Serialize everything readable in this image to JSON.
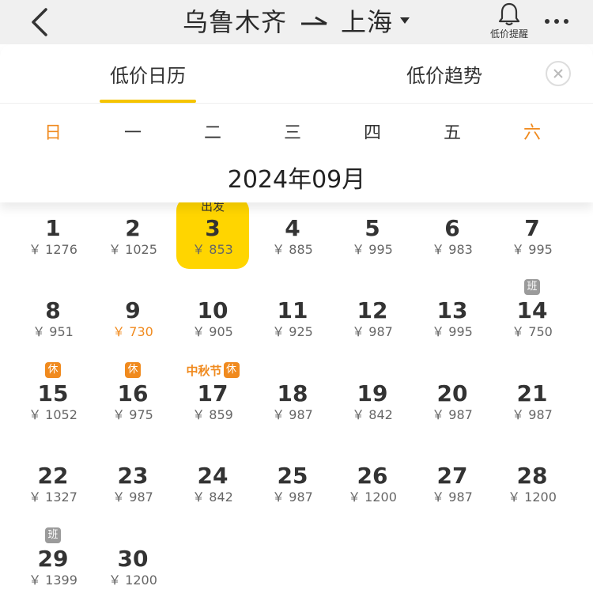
{
  "nav": {
    "origin": "乌鲁木齐",
    "destination": "上海",
    "alert_label": "低价提醒"
  },
  "tabs": {
    "calendar": "低价日历",
    "trend": "低价趋势"
  },
  "weekdays": [
    "日",
    "一",
    "二",
    "三",
    "四",
    "五",
    "六"
  ],
  "month_title": "2024年09月",
  "colors": {
    "accent": "#ffd500",
    "tab_underline": "#f5c400",
    "weekend": "#f08a1e",
    "rest_badge": "#f08a1e",
    "work_badge": "#9b9b9b"
  },
  "currency": "￥",
  "selected_label": "出发",
  "badge_labels": {
    "rest": "休",
    "work": "班"
  },
  "days": [
    {
      "day": "1",
      "price": "1276"
    },
    {
      "day": "2",
      "price": "1025"
    },
    {
      "day": "3",
      "price": "853",
      "selected": true
    },
    {
      "day": "4",
      "price": "885"
    },
    {
      "day": "5",
      "price": "995"
    },
    {
      "day": "6",
      "price": "983"
    },
    {
      "day": "7",
      "price": "995"
    },
    {
      "day": "8",
      "price": "951"
    },
    {
      "day": "9",
      "price": "730",
      "lowest": true
    },
    {
      "day": "10",
      "price": "905"
    },
    {
      "day": "11",
      "price": "925"
    },
    {
      "day": "12",
      "price": "987"
    },
    {
      "day": "13",
      "price": "995"
    },
    {
      "day": "14",
      "price": "750",
      "badge": "work"
    },
    {
      "day": "15",
      "price": "1052",
      "badge": "rest"
    },
    {
      "day": "16",
      "price": "975",
      "badge": "rest"
    },
    {
      "day": "17",
      "price": "859",
      "badge": "rest",
      "holiday": "中秋节"
    },
    {
      "day": "18",
      "price": "987"
    },
    {
      "day": "19",
      "price": "842"
    },
    {
      "day": "20",
      "price": "987"
    },
    {
      "day": "21",
      "price": "987"
    },
    {
      "day": "22",
      "price": "1327"
    },
    {
      "day": "23",
      "price": "987"
    },
    {
      "day": "24",
      "price": "842"
    },
    {
      "day": "25",
      "price": "987"
    },
    {
      "day": "26",
      "price": "1200"
    },
    {
      "day": "27",
      "price": "987"
    },
    {
      "day": "28",
      "price": "1200"
    },
    {
      "day": "29",
      "price": "1399",
      "badge": "work"
    },
    {
      "day": "30",
      "price": "1200"
    }
  ]
}
